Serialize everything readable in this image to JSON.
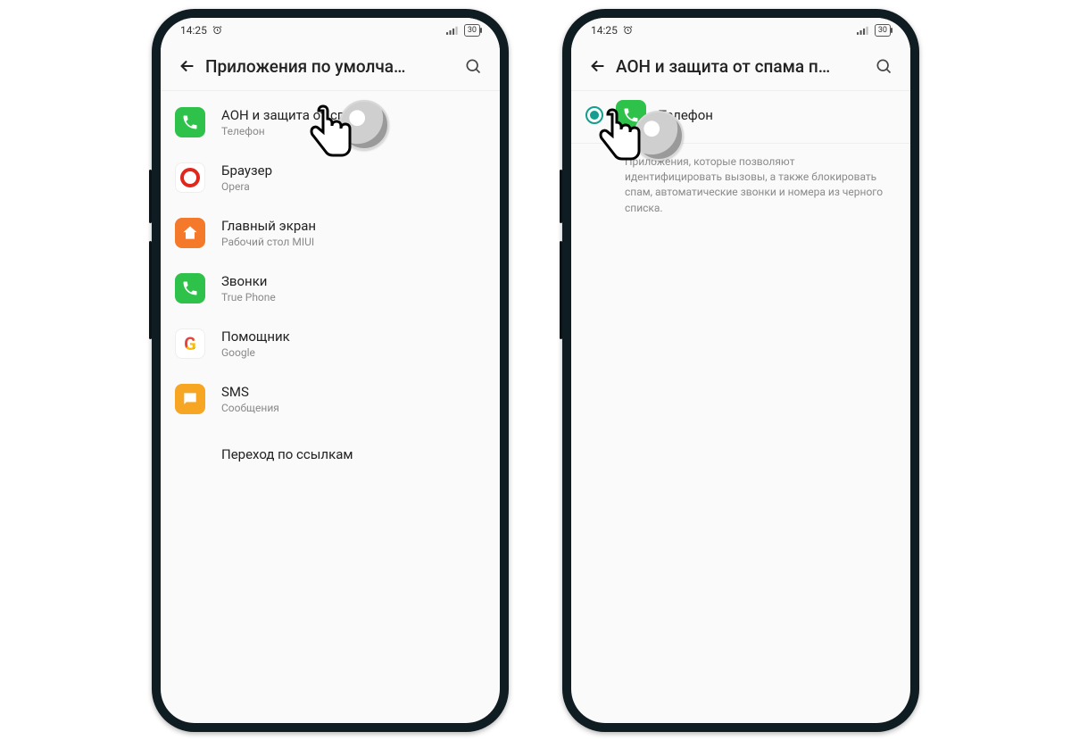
{
  "status": {
    "time": "14:25",
    "battery": "30"
  },
  "screen1": {
    "title": "Приложения по умолча…",
    "items": [
      {
        "label": "АОН и защита от спама",
        "sub": "Телефон"
      },
      {
        "label": "Браузер",
        "sub": "Opera"
      },
      {
        "label": "Главный экран",
        "sub": "Рабочий стол MIUI"
      },
      {
        "label": "Звонки",
        "sub": "True Phone"
      },
      {
        "label": "Помощник",
        "sub": "Google"
      },
      {
        "label": "SMS",
        "sub": "Сообщения"
      },
      {
        "label": "Переход по ссылкам"
      }
    ]
  },
  "screen2": {
    "title": "АОН и защита от спама п…",
    "option": {
      "label": "Телефон"
    },
    "description": "Приложения, которые позволяют идентифицировать вызовы, а также блокировать спам, автоматические звонки и номера из черного списка."
  }
}
